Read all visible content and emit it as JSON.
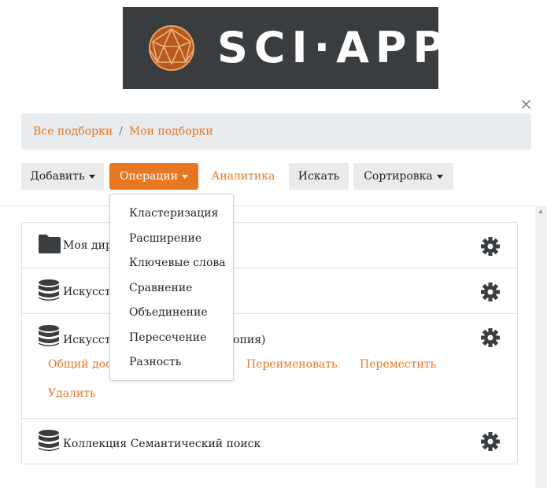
{
  "logo": {
    "text": "SCI·APP",
    "icon": "geodesic-sphere-icon"
  },
  "dialog": {
    "close_icon": "close-icon",
    "close_glyph": "×"
  },
  "breadcrumb": {
    "items": [
      "Все подборки",
      "Мои подборки"
    ],
    "separator": "/"
  },
  "toolbar": {
    "add_label": "Добавить",
    "operations_label": "Операции",
    "analytics_label": "Аналитика",
    "search_label": "Искать",
    "sort_label": "Сортировка"
  },
  "operations_menu": {
    "items": [
      "Кластеризация",
      "Расширение",
      "Ключевые слова",
      "Сравнение",
      "Объединение",
      "Пересечение",
      "Разность"
    ]
  },
  "collections": [
    {
      "icon": "folder-icon",
      "title": "Моя директория"
    },
    {
      "icon": "database-icon",
      "title": "Искусственный интеллект"
    },
    {
      "icon": "database-icon",
      "title": "Искусственный интеллект (копия)"
    },
    {
      "icon": "database-icon",
      "title": "Коллекция Семантический поиск"
    }
  ],
  "row_actions": [
    "Общий доступ",
    "Переименовать",
    "Переместить",
    "Удалить"
  ],
  "colors": {
    "accent": "#e87722",
    "logo_bg": "#3a3d40",
    "breadcrumb_bg": "#e9ecef"
  }
}
